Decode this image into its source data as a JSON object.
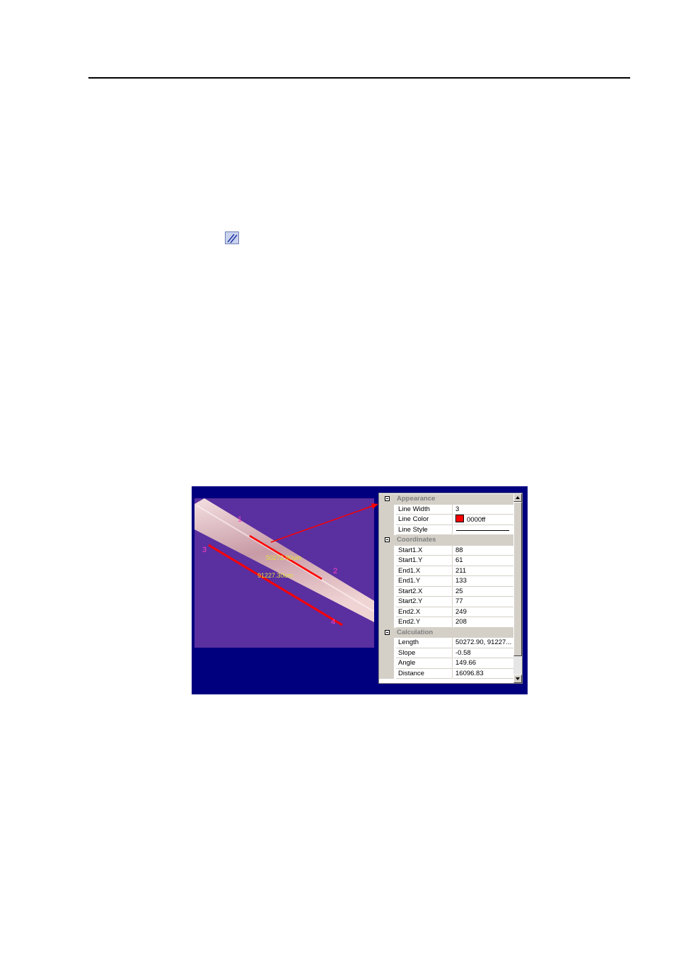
{
  "property_grid": {
    "categories": [
      {
        "label": "Appearance",
        "rows": [
          {
            "name": "Line Width",
            "value": "3"
          },
          {
            "name": "Line Color",
            "value": "0000ff",
            "swatch": "#ff0000"
          },
          {
            "name": "Line Style",
            "value": ""
          }
        ]
      },
      {
        "label": "Coordinates",
        "rows": [
          {
            "name": "Start1.X",
            "value": "88"
          },
          {
            "name": "Start1.Y",
            "value": "61"
          },
          {
            "name": "End1.X",
            "value": "211"
          },
          {
            "name": "End1.Y",
            "value": "133"
          },
          {
            "name": "Start2.X",
            "value": "25"
          },
          {
            "name": "Start2.Y",
            "value": "77"
          },
          {
            "name": "End2.X",
            "value": "249"
          },
          {
            "name": "End2.Y",
            "value": "208"
          }
        ]
      },
      {
        "label": "Calculation",
        "rows": [
          {
            "name": "Length",
            "value": "50272.90, 91227..."
          },
          {
            "name": "Slope",
            "value": "-0.58"
          },
          {
            "name": "Angle",
            "value": "149.66"
          },
          {
            "name": "Distance",
            "value": "16096.83"
          }
        ]
      }
    ]
  },
  "image_annotations": {
    "point_labels": [
      "1",
      "2",
      "3",
      "4"
    ],
    "measure_1": "50272.90um",
    "measure_2": "91227.30um"
  },
  "colors": {
    "figure_bg": "#00007e",
    "measure_line": "#ff0000",
    "point_label": "#ff40c0",
    "measure_text": "#e0e040",
    "sample_bg": "#5a2fa0"
  },
  "icons": {
    "toolbar": "parallel-lines-icon"
  }
}
